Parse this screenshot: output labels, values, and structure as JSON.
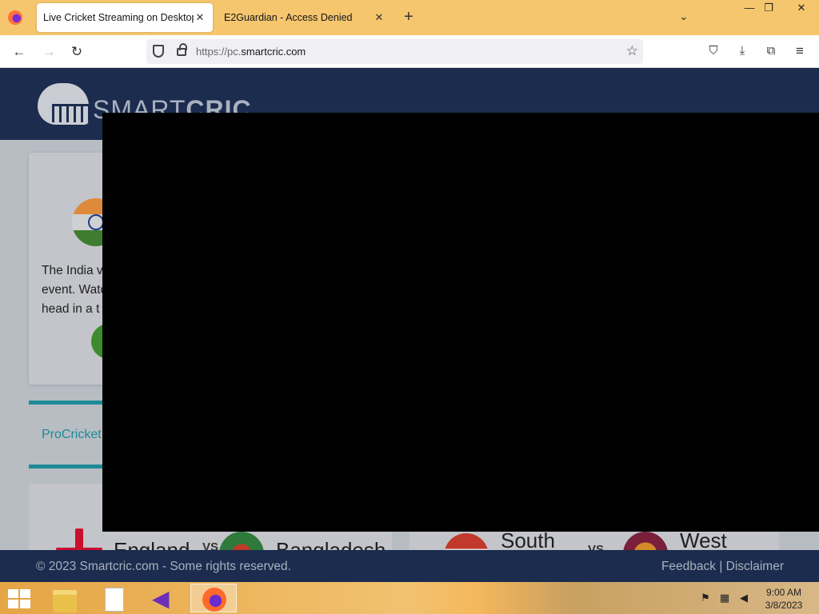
{
  "browser": {
    "tabs": [
      {
        "title": "Live Cricket Streaming on Desktop, |",
        "active": true
      },
      {
        "title": "E2Guardian - Access Denied",
        "active": false
      }
    ],
    "url_scheme": "https://pc.",
    "url_host": "smartcric.com"
  },
  "page": {
    "logo": {
      "light": "SMART",
      "bold": "CRIC"
    },
    "card1_text_lines": [
      "The India v",
      "event. Watc",
      "head in a t"
    ],
    "section_label": "ProCricket",
    "matches": [
      {
        "team1": "England",
        "vs": "VS",
        "team2": "Bangladesh"
      },
      {
        "team1": "South",
        "vs": "VS",
        "team2": "West"
      }
    ],
    "footer": {
      "copyright": "© 2023 Smartcric.com - Some rights reserved.",
      "feedback": "Feedback",
      "separator": " | ",
      "disclaimer": "Disclaimer"
    }
  },
  "taskbar": {
    "time": "9:00 AM",
    "date": "3/8/2023"
  },
  "colors": {
    "header_bg": "#1b2c4e",
    "tabstrip_bg": "#f5c66e",
    "teal_accent": "#1d8c96"
  }
}
